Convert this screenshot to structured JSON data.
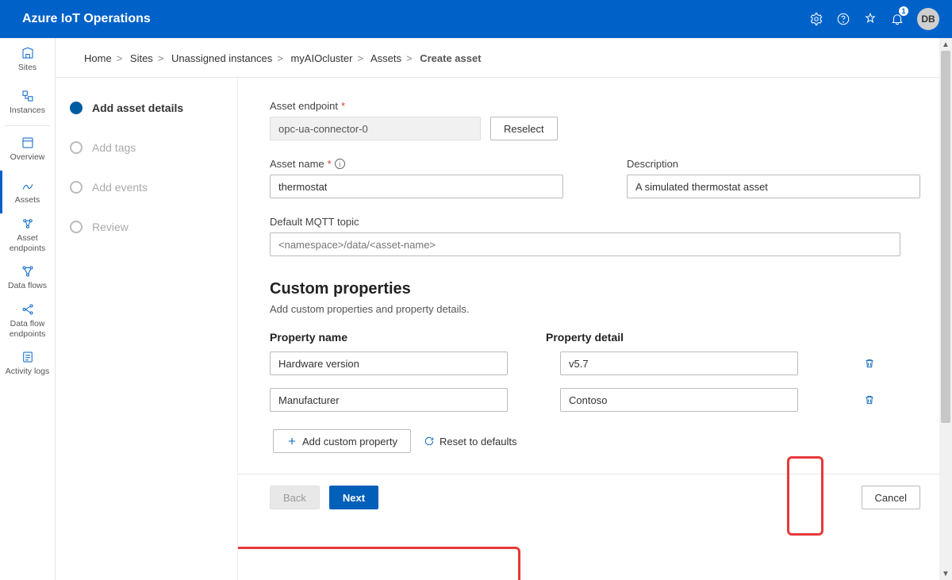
{
  "header": {
    "title": "Azure IoT Operations",
    "notification_count": "1",
    "user_initials": "DB"
  },
  "rail": {
    "items": [
      {
        "label": "Sites"
      },
      {
        "label": "Instances"
      },
      {
        "label": "Overview"
      },
      {
        "label": "Assets"
      },
      {
        "label": "Asset endpoints"
      },
      {
        "label": "Data flows"
      },
      {
        "label": "Data flow endpoints"
      },
      {
        "label": "Activity logs"
      }
    ]
  },
  "breadcrumb": {
    "items": [
      "Home",
      "Sites",
      "Unassigned instances",
      "myAIOcluster",
      "Assets"
    ],
    "current": "Create asset"
  },
  "wizard": {
    "steps": [
      {
        "label": "Add asset details",
        "active": true
      },
      {
        "label": "Add tags",
        "active": false
      },
      {
        "label": "Add events",
        "active": false
      },
      {
        "label": "Review",
        "active": false
      }
    ]
  },
  "form": {
    "endpoint_label": "Asset endpoint",
    "endpoint_value": "opc-ua-connector-0",
    "reselect": "Reselect",
    "assetname_label": "Asset name",
    "assetname_value": "thermostat",
    "description_label": "Description",
    "description_value": "A simulated thermostat asset",
    "mqtt_label": "Default MQTT topic",
    "mqtt_placeholder": "<namespace>/data/<asset-name>",
    "custom_title": "Custom properties",
    "custom_sub": "Add custom properties and property details.",
    "prop_name_header": "Property name",
    "prop_detail_header": "Property detail",
    "properties": [
      {
        "name": "Hardware version",
        "detail": "v5.7"
      },
      {
        "name": "Manufacturer",
        "detail": "Contoso"
      }
    ],
    "add_property": "Add custom property",
    "reset_defaults": "Reset to defaults"
  },
  "footer": {
    "back": "Back",
    "next": "Next",
    "cancel": "Cancel"
  }
}
